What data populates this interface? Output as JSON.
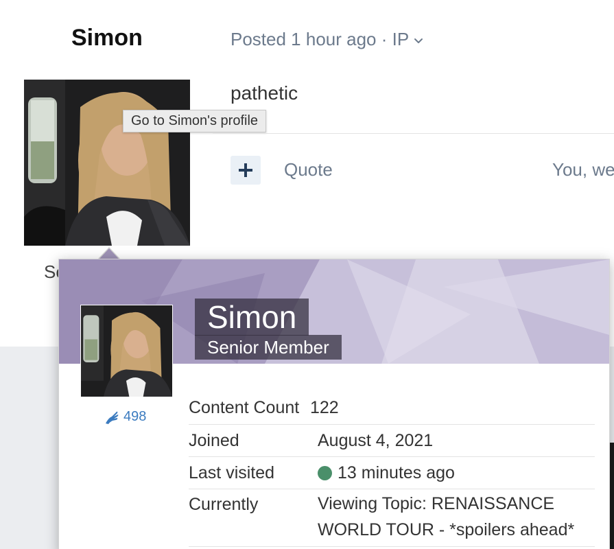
{
  "post": {
    "author": "Simon",
    "meta": "Posted 1 hour ago · IP",
    "content": "pathetic",
    "tooltip": "Go to Simon's profile",
    "quote_label": "Quote",
    "reactions_text": "You, wee",
    "rank_partial": "Se"
  },
  "hovercard": {
    "name": "Simon",
    "rank": "Senior Member",
    "reputation": "498",
    "stats": [
      {
        "label": "Content Count",
        "value": "122"
      },
      {
        "label": "Joined",
        "value": "August 4, 2021"
      },
      {
        "label": "Last visited",
        "value": "13 minutes ago"
      },
      {
        "label": "Currently",
        "value": "Viewing Topic: RENAISSANCE WORLD TOUR - *spoilers ahead*"
      }
    ]
  },
  "icons": {
    "meta_dropdown": "chevron-down-icon",
    "add_reaction": "plus-icon",
    "reputation": "reputation-icon",
    "online": "online-status-icon"
  },
  "colors": {
    "meta_text": "#6c7a8c",
    "link_blue": "#3b7bbf",
    "online_green": "#4a8f6a",
    "cover_purple": "#9e92b6"
  }
}
